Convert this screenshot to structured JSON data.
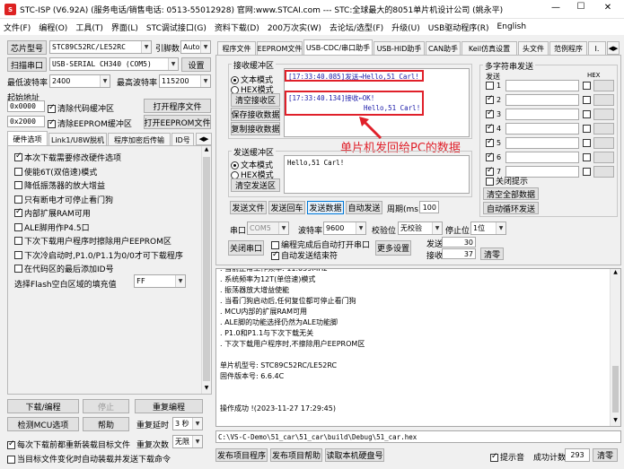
{
  "window": {
    "title": "STC-ISP (V6.92A) (服务电话/销售电话: 0513-55012928) 官网:www.STCAI.com  --- STC:全球最大的8051单片机设计公司 (姚永平)",
    "min": "—",
    "max": "☐",
    "close": "✕"
  },
  "menu": [
    "文件(F)",
    "编程(O)",
    "工具(T)",
    "界面(L)",
    "STC调试接口(G)",
    "资料下载(D)",
    "200万次实(W)",
    "去论坛/选型(F)",
    "升级(U)",
    "USB驱动程序(R)",
    "English"
  ],
  "left": {
    "chip_label": "芯片型号",
    "chip_value": "STC89C52RC/LE52RC",
    "pin_label": "引脚数",
    "pin_value": "Auto",
    "scan_btn": "扫描串口",
    "port_value": "USB-SERIAL CH340 (COM5)",
    "settings_btn": "设置",
    "min_baud_label": "最低波特率",
    "min_baud_value": "2400",
    "max_baud_label": "最高波特率",
    "max_baud_value": "115200",
    "start_addr_label": "起始地址",
    "addr1": "0x0000",
    "clear_code_label": "清除代码缓冲区",
    "open_prog_btn": "打开程序文件",
    "addr2": "0x2000",
    "clear_eeprom_label": "清除EEPROM缓冲区",
    "open_eeprom_btn": "打开EEPROM文件",
    "tabs": [
      "硬件选项",
      "Link1/U8W脱机",
      "程序加密后传输",
      "ID号"
    ],
    "options": [
      {
        "label": "本次下载需要修改硬件选项",
        "checked": true
      },
      {
        "label": "使能6T(双倍速)模式",
        "checked": false
      },
      {
        "label": "降低振荡器的放大增益",
        "checked": false
      },
      {
        "label": "只有断电才可停止看门狗",
        "checked": false
      },
      {
        "label": "内部扩展RAM可用",
        "checked": true
      },
      {
        "label": "ALE脚用作P4.5口",
        "checked": false
      },
      {
        "label": "下次下载用户程序时擦除用户EEPROM区",
        "checked": false
      },
      {
        "label": "下次冷启动时,P1.0/P1.1为0/0才可下载程序",
        "checked": false
      },
      {
        "label": "在代码区的最后添加ID号",
        "checked": false
      }
    ],
    "fill_label": "选择Flash空白区域的填充值",
    "fill_value": "FF",
    "download_btn": "下载/编程",
    "stop_btn": "停止",
    "reprog_btn": "重复编程",
    "detect_btn": "检测MCU选项",
    "help_btn": "帮助",
    "delay_label": "重复延时",
    "delay_value": "3 秒",
    "reload_label": "每次下载前都重新装载目标文件",
    "repeat_label": "重复次数",
    "repeat_value": "无限",
    "autoload_label": "当目标文件变化时自动装载并发送下载命令"
  },
  "right": {
    "tabs": [
      "程序文件",
      "EEPROM文件",
      "USB-CDC/串口助手",
      "USB-HID助手",
      "CAN助手",
      "Keil仿真设置",
      "头文件",
      "范例程序",
      "I."
    ],
    "recv_title": "接收缓冲区",
    "text_mode": "文本模式",
    "hex_mode": "HEX模式",
    "clear_recv": "清空接收区",
    "save_recv": "保存接收数据",
    "copy_recv": "复制接收数据",
    "recv_lines": [
      "[17:33:40.085]发送→Hello,51 Carl!",
      "[17:33:40.134]接收←OK!",
      "Hello,51 Carl!"
    ],
    "annotation": "单片机发回给PC的数据",
    "send_title": "发送缓冲区",
    "send_text_mode": "文本模式",
    "send_hex_mode": "HEX模式",
    "clear_send": "清空发送区",
    "send_content": "Hello,51 Carl!",
    "send_file_btn": "发送文件",
    "send_enter_btn": "发送回车",
    "send_data_btn": "发送数据",
    "auto_send_btn": "自动发送",
    "period_label": "周期(ms)",
    "period_value": "100",
    "port_label": "串口",
    "port_value": "COM5",
    "baud_label": "波特率",
    "baud_value": "9600",
    "parity_label": "校验位",
    "parity_value": "无校验",
    "stop_label": "停止位",
    "stop_value": "1位",
    "close_port_btn": "关闭串口",
    "auto_open_label": "编程完成后自动打开串口",
    "auto_end_label": "自动发送结束符",
    "more_btn": "更多设置",
    "sent_label": "发送",
    "sent_count": "30",
    "recv_label": "接收",
    "recv_count": "37",
    "clear_count_btn": "清零",
    "multi_title": "多字符串发送",
    "multi_send": "发送",
    "multi_hex": "HEX",
    "multi_rows": [
      {
        "n": "1",
        "c": false
      },
      {
        "n": "2",
        "c": true
      },
      {
        "n": "3",
        "c": true
      },
      {
        "n": "4",
        "c": true
      },
      {
        "n": "5",
        "c": true
      },
      {
        "n": "6",
        "c": true
      },
      {
        "n": "7",
        "c": true
      }
    ],
    "close_hint_label": "关闭提示",
    "clear_all_btn": "清空全部数据",
    "auto_loop_btn": "自动循环发送"
  },
  "log": {
    "lines": [
      "  . 当前正常工作频率: 11.059MHz",
      "  . 系统频率为12T(单倍速)模式",
      "  . 振荡器放大增益使能",
      "  . 当看门狗启动后,任何复位都可停止看门狗",
      "  . MCU内部的扩展RAM可用",
      "  . ALE脚的功能选择仍然为ALE功能脚",
      "  . P1.0和P1.1与下次下载无关",
      "  . 下次下载用户程序时,不擦除用户EEPROM区",
      "",
      "  单片机型号: STC89C52RC/LE52RC",
      "  固件版本号: 6.6.4C",
      "",
      "",
      "操作成功 !(2023-11-27 17:29:45)"
    ]
  },
  "path_value": "C:\\VS-C-Demo\\51_car\\51_car\\build\\Debug\\51_car.hex",
  "bottom": {
    "pub_prog": "发布项目程序",
    "pub_help": "发布项目帮助",
    "read_disk": "读取本机硬盘号",
    "hint_label": "提示音",
    "count_label": "成功计数",
    "count_value": "293",
    "clear_btn": "清零"
  }
}
